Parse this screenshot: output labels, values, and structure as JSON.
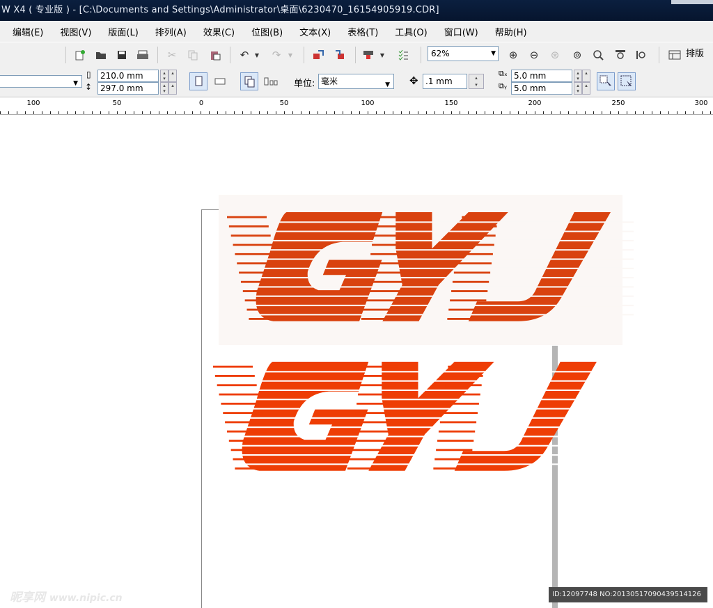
{
  "window": {
    "title": "W X4 ( 专业版 ) - [C:\\Documents and Settings\\Administrator\\桌面\\6230470_16154905919.CDR]"
  },
  "menu": [
    "编辑(E)",
    "视图(V)",
    "版面(L)",
    "排列(A)",
    "效果(C)",
    "位图(B)",
    "文本(X)",
    "表格(T)",
    "工具(O)",
    "窗口(W)",
    "帮助(H)"
  ],
  "toolbar": {
    "zoom": "62%",
    "layout_label": "排版"
  },
  "property_bar": {
    "page_width": "210.0 mm",
    "page_height": "297.0 mm",
    "unit_label": "单位:",
    "unit_value": "毫米",
    "nudge": ".1 mm",
    "dup_x": "5.0 mm",
    "dup_y": "5.0 mm"
  },
  "ruler": {
    "labels": [
      "100",
      "50",
      "0",
      "50",
      "100",
      "150",
      "200",
      "250",
      "300"
    ]
  },
  "watermark": {
    "brand": "昵享网",
    "url": "www.nipic.cn",
    "id": "ID:12097748 NO:20130517090439514126"
  },
  "colors": {
    "logo_top": "#d9420f",
    "logo_bottom": "#ee3d05",
    "titlebar": "#0b1f3f"
  }
}
